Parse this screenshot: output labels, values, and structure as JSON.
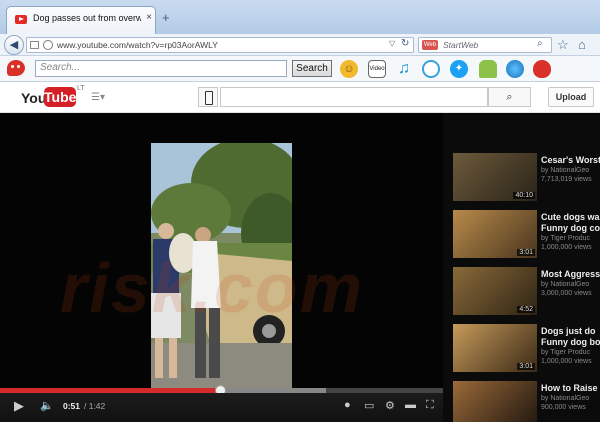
{
  "browser": {
    "tab_title": "Dog passes out from overwhel...",
    "tab_close": "×",
    "new_tab": "+",
    "url": "www.youtube.com/watch?v=rp03AorAWLY",
    "search_placeholder": "StartWeb",
    "search_engine_label": "Web"
  },
  "toolbar": {
    "search_placeholder": "Search...",
    "search_button": "Search",
    "icons": [
      "smiley-icon",
      "video-icon",
      "music-icon",
      "chat-icon",
      "twitter-icon",
      "android-icon",
      "globe-icon",
      "angry-birds-icon"
    ],
    "video_icon_label": "Video"
  },
  "youtube": {
    "logo_you": "You",
    "logo_tube": "Tube",
    "logo_region": "LT",
    "upload_button": "Upload"
  },
  "player": {
    "current_time": "0:51",
    "total_time": "/ 1:42",
    "progress_played": 0.5,
    "progress_loaded": 0.74
  },
  "sidebar": {
    "items": [
      {
        "title": "Cesar's Worst",
        "sub1": "by NationalGeo",
        "sub2": "7,713,019 views",
        "dur": "40:10"
      },
      {
        "title": "Cute dogs wa",
        "title2": "Funny dog co",
        "sub1": "by Tiger Produc",
        "sub2": "1,000,000 views",
        "dur": "3:01"
      },
      {
        "title": "Most Aggressi",
        "sub1": "by NationalGeo",
        "sub2": "3,000,000 views",
        "dur": "4:52"
      },
      {
        "title": "Dogs just do",
        "title2": "Funny dog bo",
        "sub1": "by Tiger Produc",
        "sub2": "1,000,000 views",
        "dur": "3:01"
      },
      {
        "title": "How to Raise",
        "sub1": "by NationalGeo",
        "sub2": "900,000 views",
        "dur": ""
      }
    ]
  },
  "watermark": "risk.com"
}
